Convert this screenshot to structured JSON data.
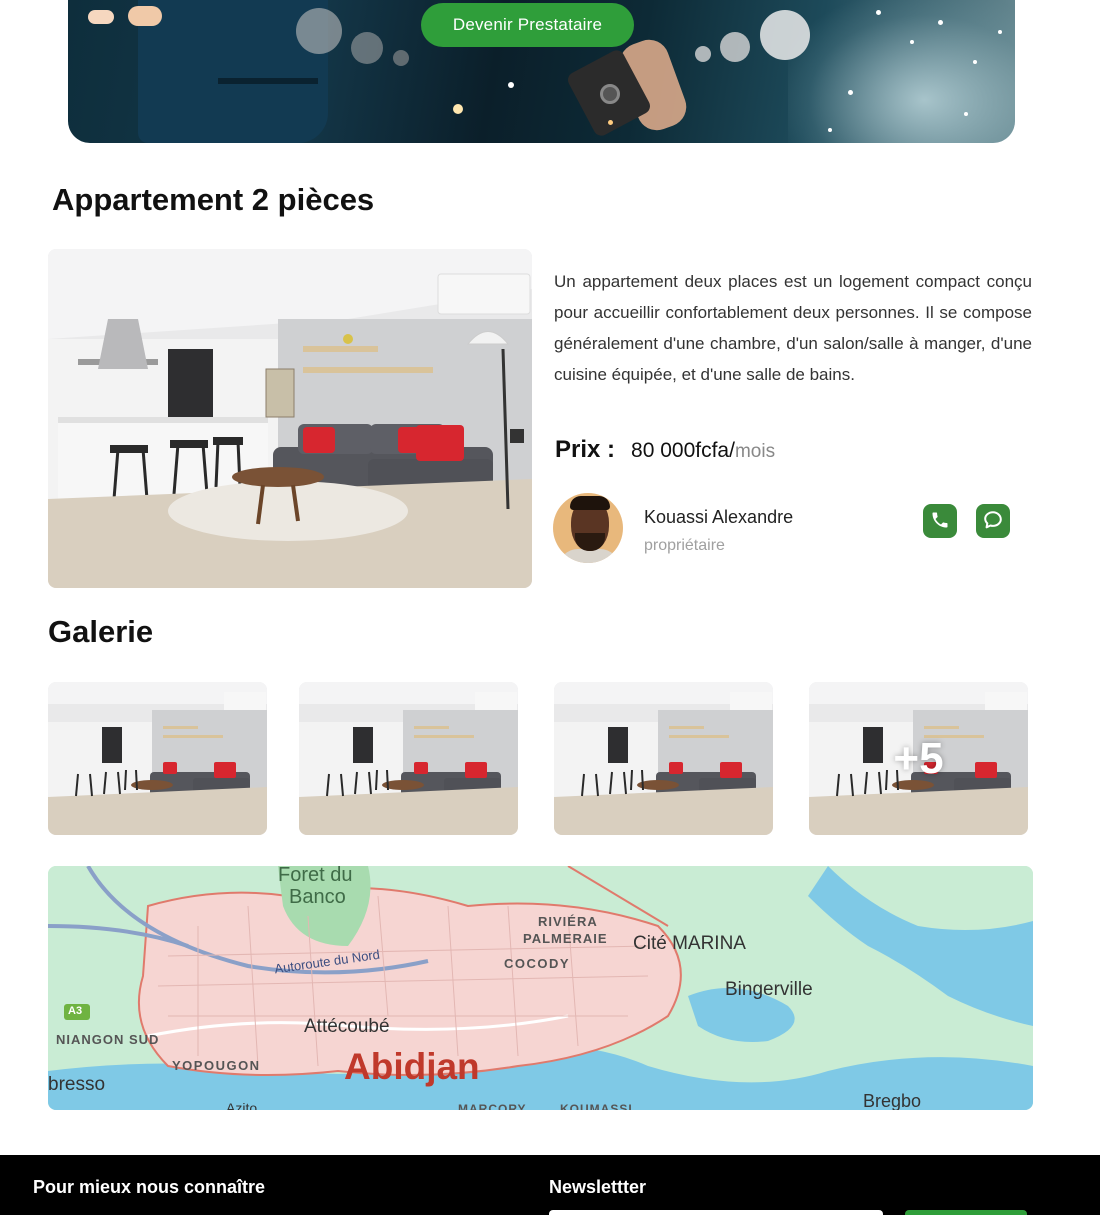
{
  "hero": {
    "cta_label": "Devenir Prestataire"
  },
  "listing": {
    "title": "Appartement 2 pièces",
    "description": "Un appartement deux places est un logement compact conçu pour accueillir confortablement deux personnes. Il se compose généralement d'une chambre, d'un salon/salle à manger, d'une cuisine équipée, et d'une salle de bains.",
    "price_label": "Prix :",
    "price_value": "80 000fcfa/",
    "price_unit": "mois",
    "owner": {
      "name": "Kouassi Alexandre",
      "role": "propriétaire"
    },
    "contact": {
      "phone_icon": "phone-icon",
      "chat_icon": "chat-icon"
    }
  },
  "gallery": {
    "title": "Galerie",
    "more_count": "+5"
  },
  "map": {
    "labels": {
      "foret": "Foret du",
      "banco": "Banco",
      "riviera": "RIVIÉRA",
      "palmeraie": "PALMERAIE",
      "cite_marina": "Cité MARINA",
      "cocody": "COCODY",
      "autoroute": "Autoroute du Nord",
      "bingerville": "Bingerville",
      "a3": "A3",
      "niangon": "NIANGON SUD",
      "attecoube": "Attécoubé",
      "yopougon": "YOPOUGON",
      "abidjan": "Abidjan",
      "bresso": "bresso",
      "azito": "Azito",
      "marcory": "MARCORY",
      "koumassi": "KOUMASSI",
      "bregbo": "Bregbo"
    }
  },
  "footer": {
    "about_heading": "Pour mieux nous connaître",
    "newsletter_heading": "Newslettter"
  },
  "colors": {
    "brand_green": "#2f9e3a",
    "contact_green": "#3a8a3a",
    "footer_bg": "#000000"
  }
}
